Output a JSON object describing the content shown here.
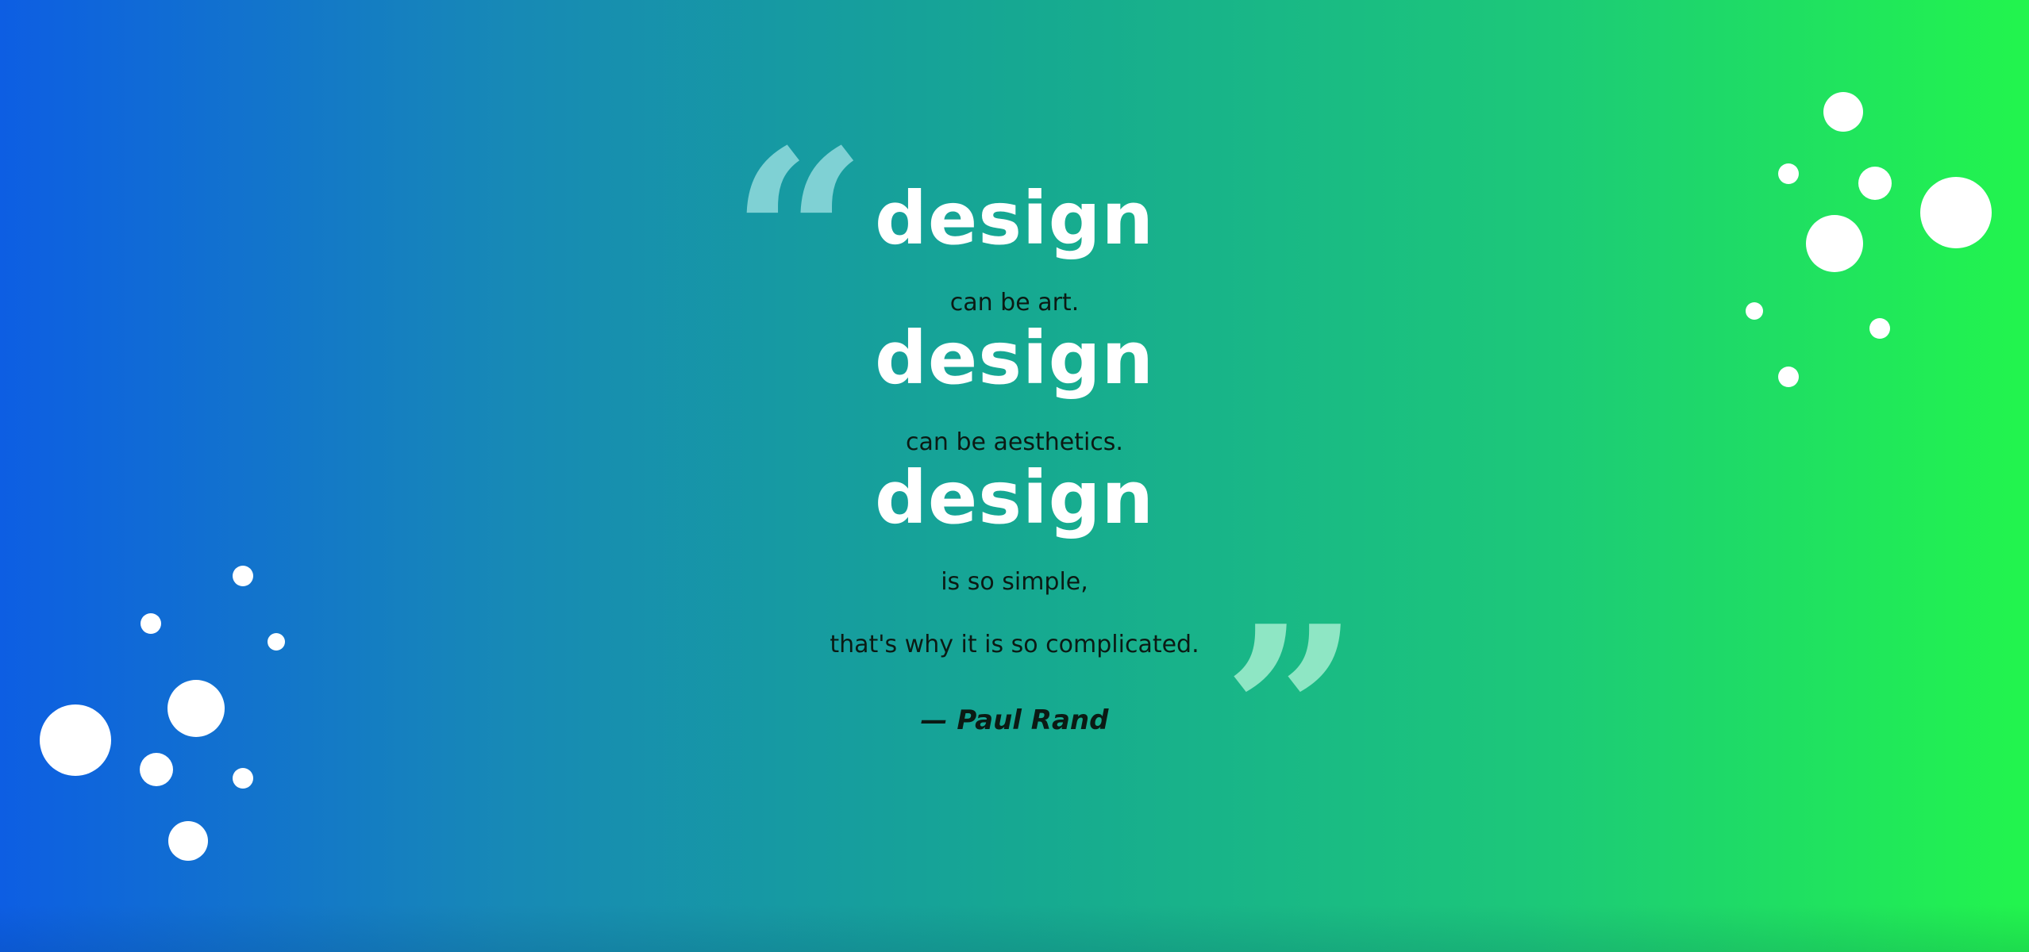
{
  "quote": {
    "lines": [
      {
        "text": "design",
        "style": "word"
      },
      {
        "text": "can be art.",
        "style": "phrase"
      },
      {
        "text": "design",
        "style": "word"
      },
      {
        "text": "can be aesthetics.",
        "style": "phrase"
      },
      {
        "text": "design",
        "style": "word"
      },
      {
        "text": "is so simple,",
        "style": "phrase"
      },
      {
        "text": "that's why it is so complicated.",
        "style": "phrase"
      }
    ],
    "author": "— Paul Rand",
    "open_mark": "“",
    "close_mark": "”"
  },
  "colors": {
    "gradient_start": "#0d5ee3",
    "gradient_end": "#22f54d",
    "word": "#ffffff",
    "phrase": "#0b1a14",
    "open_mark": "#7fd1d4",
    "close_mark": "#8ee6c4"
  },
  "decorations": {
    "icon": "bubble-cluster-icon"
  }
}
